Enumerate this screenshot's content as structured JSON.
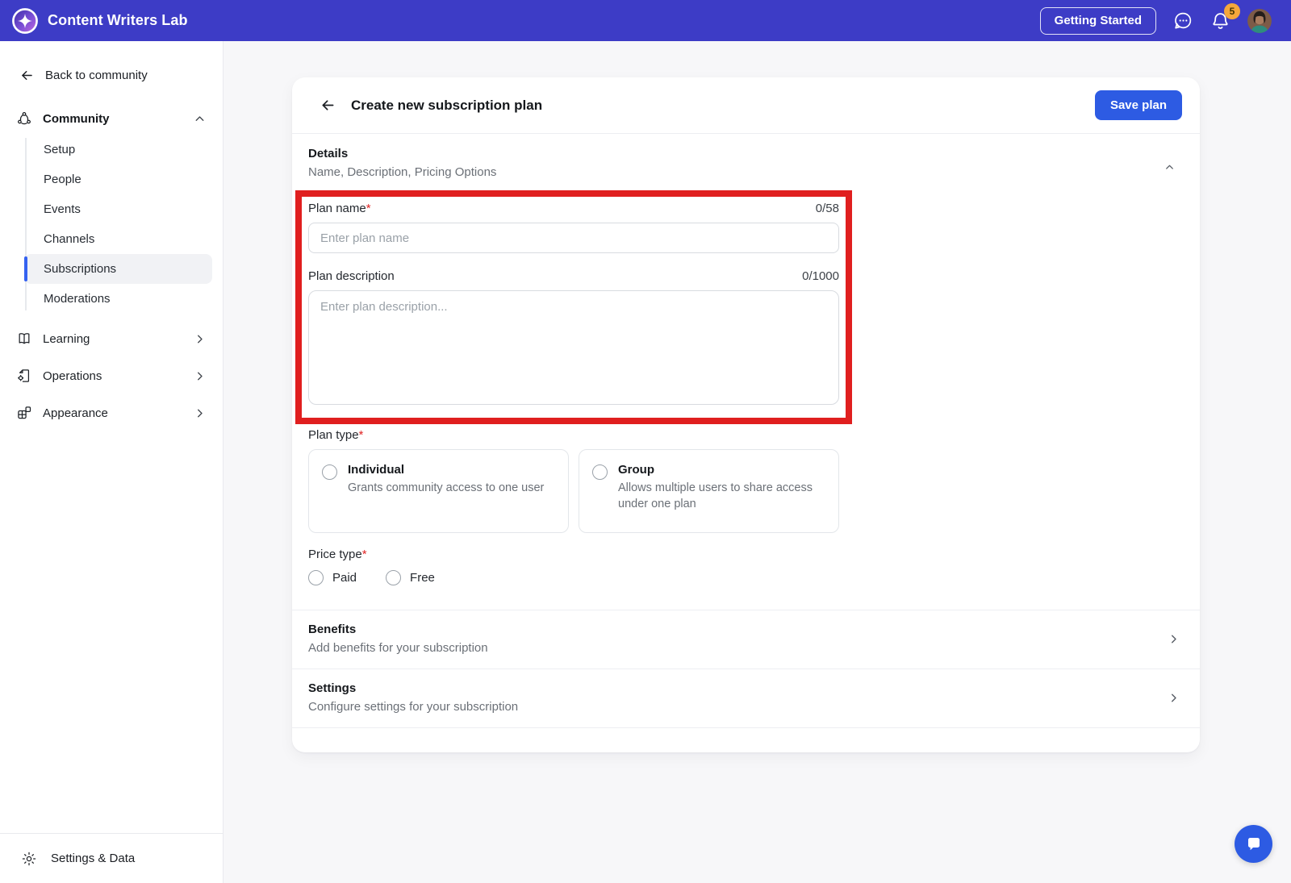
{
  "header": {
    "brand": "Content Writers Lab",
    "getting_started": "Getting Started",
    "notification_count": "5"
  },
  "sidebar": {
    "back": "Back to community",
    "community": {
      "label": "Community",
      "items": [
        {
          "label": "Setup"
        },
        {
          "label": "People"
        },
        {
          "label": "Events"
        },
        {
          "label": "Channels"
        },
        {
          "label": "Subscriptions",
          "active": true
        },
        {
          "label": "Moderations"
        }
      ]
    },
    "sections": [
      {
        "label": "Learning"
      },
      {
        "label": "Operations"
      },
      {
        "label": "Appearance"
      }
    ],
    "footer": {
      "label": "Settings & Data"
    }
  },
  "main": {
    "title": "Create new subscription plan",
    "save_button": "Save plan",
    "details": {
      "title": "Details",
      "subtitle": "Name, Description, Pricing Options"
    },
    "plan_name": {
      "label": "Plan name",
      "required": "*",
      "counter": "0/58",
      "placeholder": "Enter plan name"
    },
    "plan_description": {
      "label": "Plan description",
      "counter": "0/1000",
      "placeholder": "Enter plan description..."
    },
    "plan_type": {
      "label": "Plan type",
      "required": "*",
      "options": [
        {
          "title": "Individual",
          "description": "Grants community access to one user"
        },
        {
          "title": "Group",
          "description": "Allows multiple users to share access under one plan"
        }
      ]
    },
    "price_type": {
      "label": "Price type",
      "required": "*",
      "options": [
        "Paid",
        "Free"
      ]
    },
    "benefits": {
      "title": "Benefits",
      "subtitle": "Add benefits for your subscription"
    },
    "settings": {
      "title": "Settings",
      "subtitle": "Configure settings for your subscription"
    }
  },
  "colors": {
    "header_bg": "#3d3cc6",
    "accent_blue": "#2d5be3",
    "active_item_bar": "#3562f0",
    "annotation_red": "#e01f1f",
    "badge_orange": "#f5a73b"
  }
}
